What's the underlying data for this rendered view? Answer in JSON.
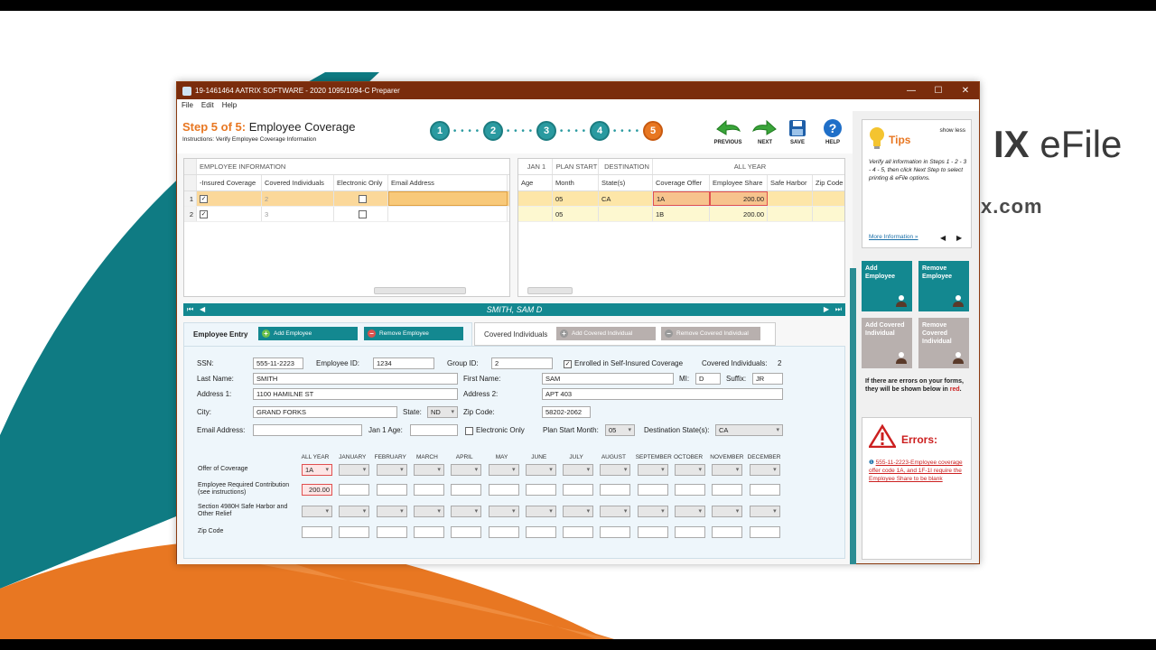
{
  "window": {
    "title": "19-1461464 AATRIX SOFTWARE - 2020 1095/1094-C Preparer",
    "menu": [
      "File",
      "Edit",
      "Help"
    ]
  },
  "background": {
    "brand_bold": "IX",
    "brand_light": " eFile",
    "url_fragment": "x.com",
    "colors": {
      "teal": "#0f7b83",
      "orange": "#e87722"
    }
  },
  "header": {
    "step_prefix": "Step 5 of 5:",
    "step_title": " Employee Coverage",
    "instructions": "Instructions: Verify Employee Coverage Information",
    "steps": [
      "1",
      "2",
      "3",
      "4",
      "5"
    ],
    "active_step": 5,
    "toolbar": {
      "previous": "PREVIOUS",
      "next": "NEXT",
      "save": "SAVE",
      "help": "HELP"
    }
  },
  "left_grid": {
    "group_header": "EMPLOYEE INFORMATION",
    "columns": [
      "-Insured Coverage",
      "Covered Individuals",
      "Electronic Only",
      "Email Address"
    ],
    "rows": [
      {
        "num": "1",
        "insured": true,
        "covered": "2",
        "electronic": false,
        "email": ""
      },
      {
        "num": "2",
        "insured": true,
        "covered": "3",
        "electronic": false,
        "email": ""
      }
    ]
  },
  "right_grid": {
    "group_headers": [
      "JAN 1",
      "PLAN START",
      "DESTINATION",
      "ALL YEAR"
    ],
    "columns": [
      "Age",
      "Month",
      "State(s)",
      "Coverage Offer",
      "Employee Share",
      "Safe Harbor",
      "Zip Code"
    ],
    "rows": [
      {
        "age": "",
        "month": "05",
        "states": "CA",
        "offer": "1A",
        "share": "200.00",
        "harbor": "",
        "zip": ""
      },
      {
        "age": "",
        "month": "05",
        "states": "",
        "offer": "1B",
        "share": "200.00",
        "harbor": "",
        "zip": ""
      }
    ]
  },
  "employee_bar": {
    "name": "SMITH, SAM D"
  },
  "tabs": {
    "employee_entry": "Employee Entry",
    "add_employee": "Add Employee",
    "remove_employee": "Remove Employee",
    "covered_individuals": "Covered Individuals",
    "add_covered": "Add Covered Individual",
    "remove_covered": "Remove Covered Individual"
  },
  "form": {
    "ssn_label": "SSN:",
    "ssn": "555-11-2223",
    "empid_label": "Employee ID:",
    "empid": "1234",
    "groupid_label": "Group ID:",
    "groupid": "2",
    "selfinsured_label": "Enrolled in Self-Insured Coverage",
    "selfinsured": true,
    "covered_label": "Covered Individuals:",
    "covered": "2",
    "last_label": "Last Name:",
    "last": "SMITH",
    "first_label": "First Name:",
    "first": "SAM",
    "mi_label": "MI:",
    "mi": "D",
    "suffix_label": "Suffix:",
    "suffix": "JR",
    "addr1_label": "Address 1:",
    "addr1": "1100 HAMILNE ST",
    "addr2_label": "Address 2:",
    "addr2": "APT 403",
    "city_label": "City:",
    "city": "GRAND FORKS",
    "state_label": "State:",
    "state": "ND",
    "zip_label": "Zip Code:",
    "zip": "58202-2062",
    "email_label": "Email Address:",
    "email": "",
    "age_label": "Jan 1 Age:",
    "age": "",
    "electronic_label": "Electronic Only",
    "electronic": false,
    "planstart_label": "Plan Start Month:",
    "planstart": "05",
    "dest_label": "Destination State(s):",
    "dest": "CA"
  },
  "monthly": {
    "months": [
      "ALL YEAR",
      "JANUARY",
      "FEBRUARY",
      "MARCH",
      "APRIL",
      "MAY",
      "JUNE",
      "JULY",
      "AUGUST",
      "SEPTEMBER",
      "OCTOBER",
      "NOVEMBER",
      "DECEMBER"
    ],
    "rows": [
      "Offer of Coverage",
      "Employee Required Contribution (see instructions)",
      "Section 4980H Safe Harbor and Other Relief",
      "Zip Code"
    ],
    "offer_all_year": "1A",
    "contribution_all_year": "200.00"
  },
  "sidebar": {
    "tips_title": "Tips",
    "show_less": "show less",
    "tips_text": "Verify all information in Steps 1 - 2 - 3 - 4 - 5, then click Next Step to select printing & eFile options.",
    "more_info": "More Information »",
    "tiles": [
      "Add Employee",
      "Remove Employee",
      "Add Covered Individual",
      "Remove Covered Individual"
    ],
    "errors_note_pre": "If there are errors on your forms, they will be shown below in ",
    "errors_note_red": "red",
    "errors_note_post": ".",
    "errors_title": "Errors:",
    "error_text": "555-11-2223-Employee coverage offer code 1A, and 1F-1I require the Employee Share to be blank"
  }
}
